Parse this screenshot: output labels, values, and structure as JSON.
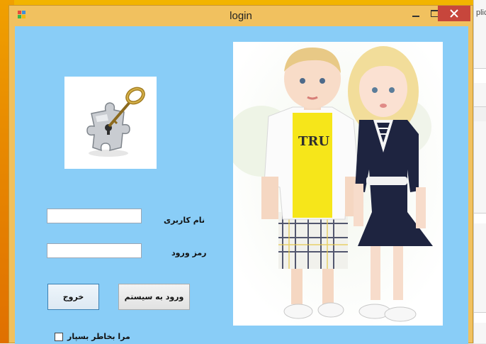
{
  "window": {
    "title": "login"
  },
  "background": {
    "right_text": "plic"
  },
  "form": {
    "username_label": "نام کاربری",
    "password_label": "رمز ورود",
    "username_value": "",
    "password_value": "",
    "login_button": "ورود به سیستم",
    "exit_button": "خروج",
    "remember_label": "مرا بخاطر بسپار",
    "remember_checked": false
  },
  "photo": {
    "shirt_text": "TRU"
  },
  "colors": {
    "window_frame": "#f1c15f",
    "client_bg": "#89cdf7",
    "close_button": "#c7463c"
  },
  "icons": {
    "app": "window-app-icon",
    "key": "puzzle-key-icon"
  }
}
